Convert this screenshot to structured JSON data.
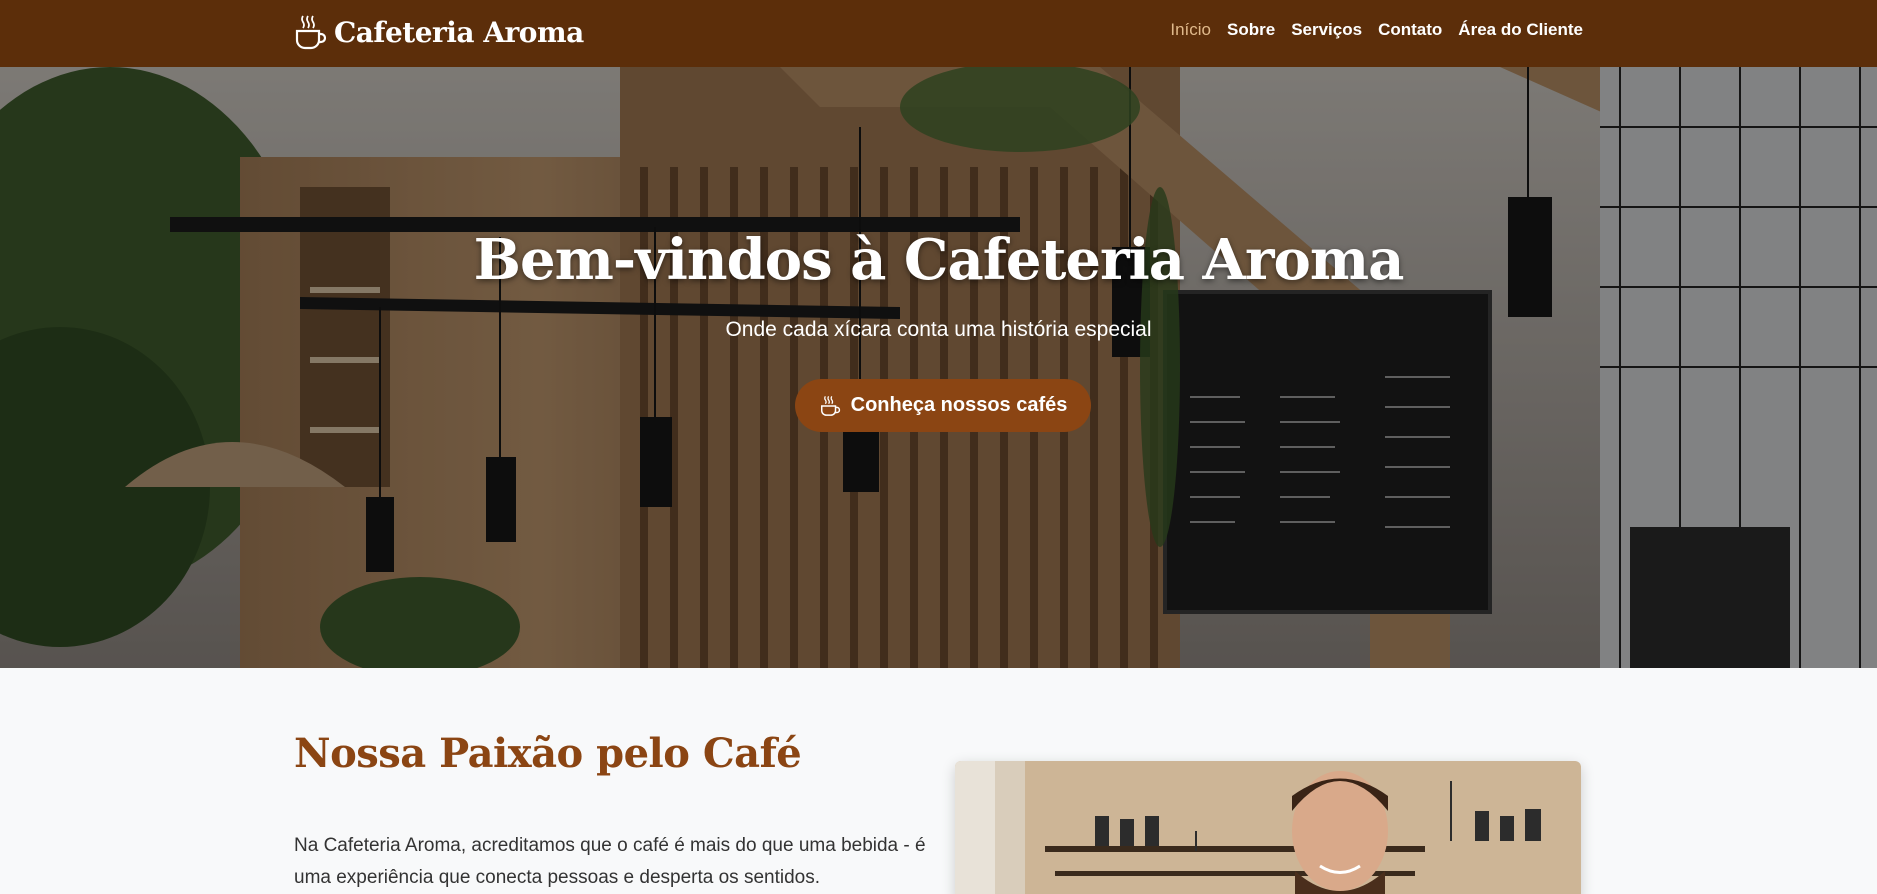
{
  "navbar": {
    "brand": "Cafeteria Aroma",
    "brand_icon": "coffee-cup-icon",
    "bg_color": "#5c2e0a",
    "links": [
      {
        "label": "Início",
        "active": true
      },
      {
        "label": "Sobre",
        "active": false
      },
      {
        "label": "Serviços",
        "active": false
      },
      {
        "label": "Contato",
        "active": false
      },
      {
        "label": "Área do Cliente",
        "active": false
      }
    ]
  },
  "hero": {
    "title": "Bem-vindos à Cafeteria Aroma",
    "subtitle": "Onde cada xícara conta uma história especial",
    "button_label": "Conheça nossos cafés",
    "button_icon": "coffee-cup-icon",
    "button_color": "#8b4513"
  },
  "about": {
    "title": "Nossa Paixão pelo Café",
    "text": "Na Cafeteria Aroma, acreditamos que o café é mais do que uma bebida - é uma experiência que conecta pessoas e desperta os sentidos.",
    "accent_color": "#8b4513"
  }
}
